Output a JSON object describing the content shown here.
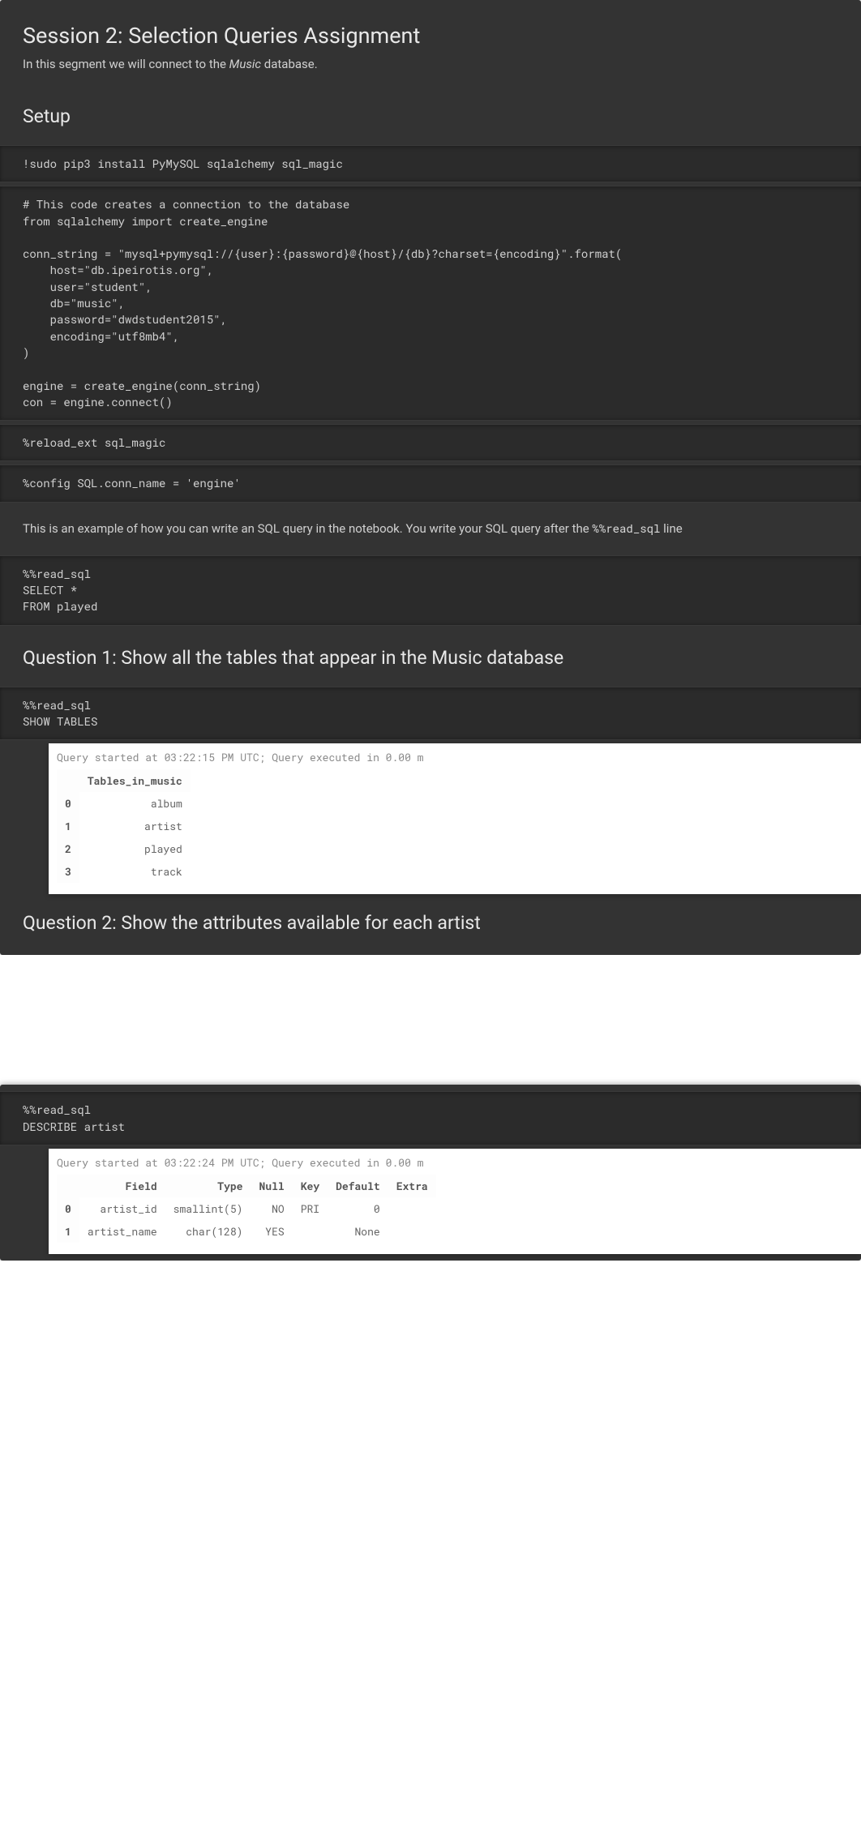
{
  "header": {
    "title": "Session 2: Selection Queries Assignment",
    "intro_prefix": "In this segment we will connect to the ",
    "intro_em": "Music",
    "intro_suffix": " database."
  },
  "setup_heading": "Setup",
  "cells": {
    "install": "!sudo pip3 install PyMySQL sqlalchemy sql_magic",
    "conn": "# This code creates a connection to the database\nfrom sqlalchemy import create_engine\n\nconn_string = \"mysql+pymysql://{user}:{password}@{host}/{db}?charset={encoding}\".format(\n    host=\"db.ipeirotis.org\",\n    user=\"student\",\n    db=\"music\",\n    password=\"dwdstudent2015\",\n    encoding=\"utf8mb4\",\n)\n\nengine = create_engine(conn_string)\ncon = engine.connect()",
    "reload": "%reload_ext sql_magic",
    "config": "%config SQL.conn_name = 'engine'",
    "example_intro_prefix": "This is an example of how you can write an SQL query in the notebook. You write your SQL query after the ",
    "example_intro_code": "%%read_sql",
    "example_intro_suffix": " line",
    "example_query": "%%read_sql\nSELECT *\nFROM played"
  },
  "q1": {
    "heading": "Question 1: Show all the tables that appear in the Music database",
    "code": "%%read_sql\nSHOW TABLES",
    "stream": "Query started at 03:22:15 PM UTC; Query executed in 0.00 m",
    "table": {
      "columns": [
        "Tables_in_music"
      ],
      "rows": [
        {
          "idx": "0",
          "cells": [
            "album"
          ]
        },
        {
          "idx": "1",
          "cells": [
            "artist"
          ]
        },
        {
          "idx": "2",
          "cells": [
            "played"
          ]
        },
        {
          "idx": "3",
          "cells": [
            "track"
          ]
        }
      ]
    }
  },
  "q2": {
    "heading": "Question 2: Show the attributes available for each artist",
    "code": "%%read_sql\nDESCRIBE artist",
    "stream": "Query started at 03:22:24 PM UTC; Query executed in 0.00 m",
    "table": {
      "columns": [
        "Field",
        "Type",
        "Null",
        "Key",
        "Default",
        "Extra"
      ],
      "rows": [
        {
          "idx": "0",
          "cells": [
            "artist_id",
            "smallint(5)",
            "NO",
            "PRI",
            "0",
            ""
          ]
        },
        {
          "idx": "1",
          "cells": [
            "artist_name",
            "char(128)",
            "YES",
            "",
            "None",
            ""
          ]
        }
      ]
    }
  }
}
